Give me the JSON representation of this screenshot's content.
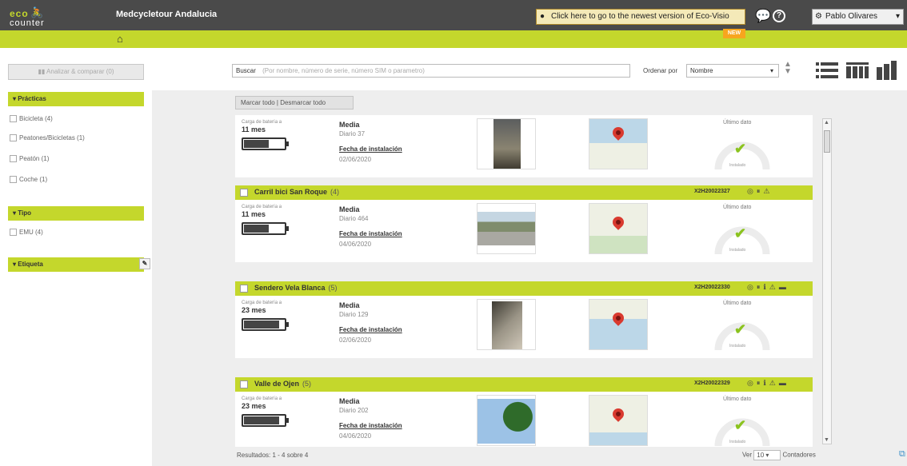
{
  "header": {
    "logo_top": "eco",
    "logo_bottom": "counter",
    "site_title": "Medcycletour Andalucia",
    "new_version_text": "Click here to go to the newest version of Eco-Visio",
    "new_badge": "NEW",
    "user_name": "Pablo Olivares"
  },
  "sidebar": {
    "compare_button": "Analizar & comparar (0)",
    "sections": [
      {
        "title": "Prácticas",
        "items": [
          "Bicicleta (4)",
          "Peatones/Bicicletas (1)",
          "Peatón (1)",
          "Coche (1)"
        ]
      },
      {
        "title": "Tipo",
        "items": [
          "EMU (4)"
        ]
      },
      {
        "title": "Etiqueta",
        "items": []
      }
    ]
  },
  "toolbar": {
    "search_button": "Buscar",
    "search_placeholder": "(Por nombre, número de serie, número SIM o parametro)",
    "order_label": "Ordenar por",
    "order_value": "Nombre"
  },
  "list": {
    "toggle_text": "Marcar todo  |  Desmarcar todo",
    "battery_label": "Carga de batería a",
    "media_label": "Media",
    "install_label": "Fecha de instalación",
    "last_data_label": "Último dato",
    "gauge_sub": "Instalado",
    "cards": [
      {
        "name": "",
        "count": "",
        "serial": "",
        "battery_value": "11 mes",
        "battery_level": 0.6,
        "battery_pct": "",
        "media_value": "Diario 37",
        "install_date": "02/06/2020"
      },
      {
        "name": "Carril bici San Roque",
        "count": "(4)",
        "serial": "X2H20022327",
        "battery_value": "11 mes",
        "battery_level": 0.6,
        "battery_pct": "",
        "media_value": "Diario 464",
        "install_date": "04/06/2020"
      },
      {
        "name": "Sendero Vela Blanca",
        "count": "(5)",
        "serial": "X2H20022330",
        "battery_value": "23 mes",
        "battery_level": 0.85,
        "battery_pct": "",
        "media_value": "Diario 129",
        "install_date": "02/06/2020"
      },
      {
        "name": "Valle de Ojen",
        "count": "(5)",
        "serial": "X2H20022329",
        "battery_value": "23 mes",
        "battery_level": 0.85,
        "battery_pct": "",
        "media_value": "Diario 202",
        "install_date": "04/06/2020"
      }
    ]
  },
  "footer": {
    "results": "Resultados: 1 - 4 sobre 4",
    "view_label": "Ver",
    "per_page": "10",
    "counters_label": "Contadores"
  },
  "colors": {
    "accent": "#c4d72c",
    "topbar": "#4a4a4a"
  }
}
